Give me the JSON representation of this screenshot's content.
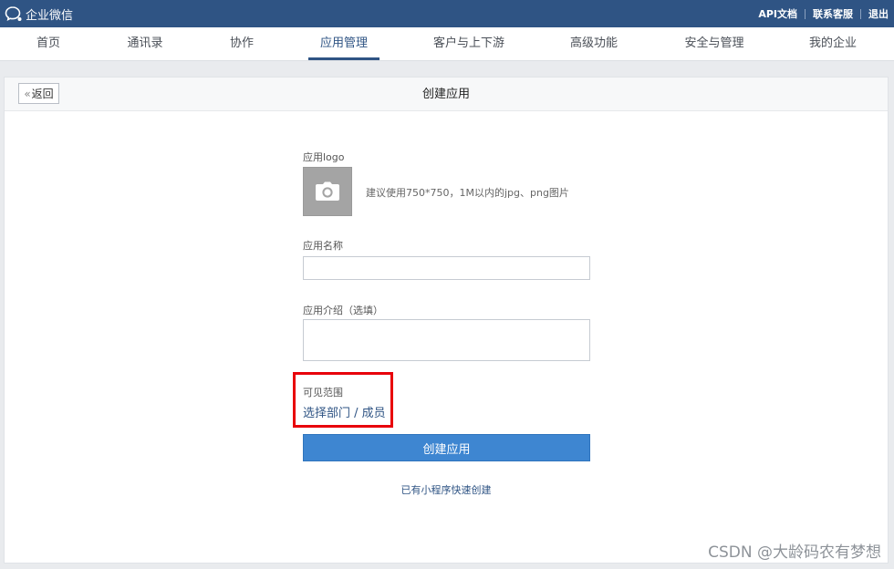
{
  "brand": {
    "name": "企业微信"
  },
  "top_links": [
    "API文档",
    "联系客服",
    "退出"
  ],
  "nav": {
    "items": [
      "首页",
      "通讯录",
      "协作",
      "应用管理",
      "客户与上下游",
      "高级功能",
      "安全与管理",
      "我的企业"
    ],
    "active": "应用管理"
  },
  "panel": {
    "back_label": "返回",
    "title": "创建应用"
  },
  "form": {
    "logo_label": "应用logo",
    "logo_hint": "建议使用750*750，1M以内的jpg、png图片",
    "name_label": "应用名称",
    "name_value": "",
    "intro_label": "应用介绍（选填）",
    "intro_value": "",
    "range_label": "可见范围",
    "range_link": "选择部门 / 成员",
    "submit_label": "创建应用",
    "mini_program_link": "已有小程序快速创建"
  },
  "watermark": "CSDN @大龄码农有梦想",
  "colors": {
    "topbar": "#2f5484",
    "primary_button": "#3e86d1",
    "highlight_border": "#e8000b"
  }
}
